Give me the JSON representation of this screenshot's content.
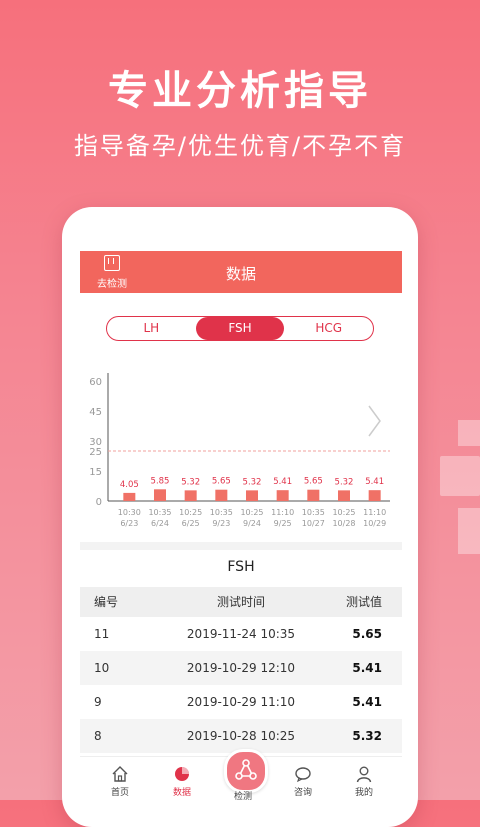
{
  "hero": {
    "title": "专业分析指导",
    "subtitle": "指导备孕/优生优育/不孕不育"
  },
  "header": {
    "back_label": "去检测",
    "title": "数据"
  },
  "tabs": [
    {
      "label": "LH",
      "active": false
    },
    {
      "label": "FSH",
      "active": true
    },
    {
      "label": "HCG",
      "active": false
    }
  ],
  "colors": {
    "accent": "#e0334a",
    "header": "#f2665d",
    "bar": "#f07166",
    "reference_line": "#f0a09c"
  },
  "chart_data": {
    "type": "bar",
    "categories": [
      "10:30\n6/23",
      "10:35\n6/24",
      "10:25\n6/25",
      "10:35\n9/23",
      "10:25\n9/24",
      "11:10\n9/25",
      "10:35\n10/27",
      "10:25\n10/28",
      "11:10\n10/29"
    ],
    "category_times": [
      "10:30",
      "10:35",
      "10:25",
      "10:35",
      "10:25",
      "11:10",
      "10:35",
      "10:25",
      "11:10"
    ],
    "category_dates": [
      "6/23",
      "6/24",
      "6/25",
      "9/23",
      "9/24",
      "9/25",
      "10/27",
      "10/28",
      "10/29"
    ],
    "values": [
      4.05,
      5.85,
      5.32,
      5.65,
      5.32,
      5.41,
      5.65,
      5.32,
      5.41
    ],
    "y_ticks": [
      0,
      15,
      25,
      30,
      45,
      60
    ],
    "ylim": [
      0,
      60
    ],
    "reference_line": 25,
    "title": "",
    "xlabel": "",
    "ylabel": ""
  },
  "table": {
    "title": "FSH",
    "columns": [
      "编号",
      "测试时间",
      "测试值"
    ],
    "rows": [
      {
        "id": "11",
        "time": "2019-11-24  10:35",
        "value": "5.65"
      },
      {
        "id": "10",
        "time": "2019-10-29  12:10",
        "value": "5.41"
      },
      {
        "id": "9",
        "time": "2019-10-29  11:10",
        "value": "5.41"
      },
      {
        "id": "8",
        "time": "2019-10-28  10:25",
        "value": "5.32"
      }
    ]
  },
  "tabbar": [
    {
      "label": "首页",
      "icon": "home-icon"
    },
    {
      "label": "数据",
      "icon": "pie-chart-icon",
      "active": true
    },
    {
      "label": "检测",
      "icon": "share-nodes-icon"
    },
    {
      "label": "咨询",
      "icon": "chat-icon"
    },
    {
      "label": "我的",
      "icon": "user-icon"
    }
  ]
}
